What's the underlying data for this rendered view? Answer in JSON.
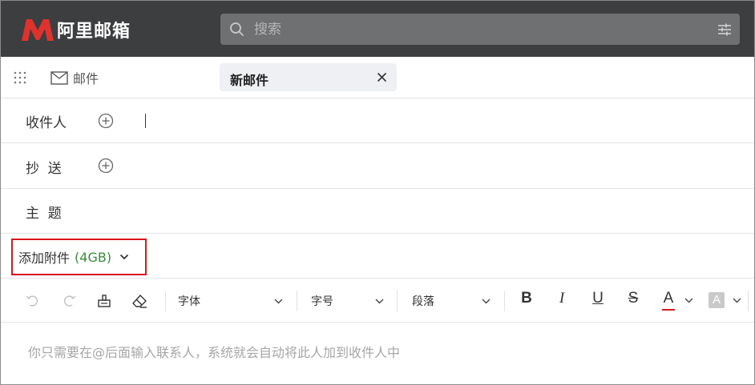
{
  "header": {
    "logo_text": "阿里邮箱",
    "brand_color": "#e0322c",
    "search_placeholder": "搜索"
  },
  "nav": {
    "mail_label": "邮件",
    "tab_label": "新邮件"
  },
  "compose": {
    "to_label": "收件人",
    "cc_label": "抄  送",
    "subject_label": "主  题",
    "attach_label": "添加附件",
    "attach_size": "(4GB)",
    "body_placeholder": "你只需要在@后面输入联系人，系统就会自动将此人加到收件人中"
  },
  "toolbar": {
    "font_label": "字体",
    "size_label": "字号",
    "paragraph_label": "段落",
    "bold_label": "B",
    "italic_label": "I",
    "underline_label": "U",
    "strike_label": "S",
    "font_color_label": "A",
    "bg_color_label": "A",
    "font_color": "#d9161c"
  }
}
